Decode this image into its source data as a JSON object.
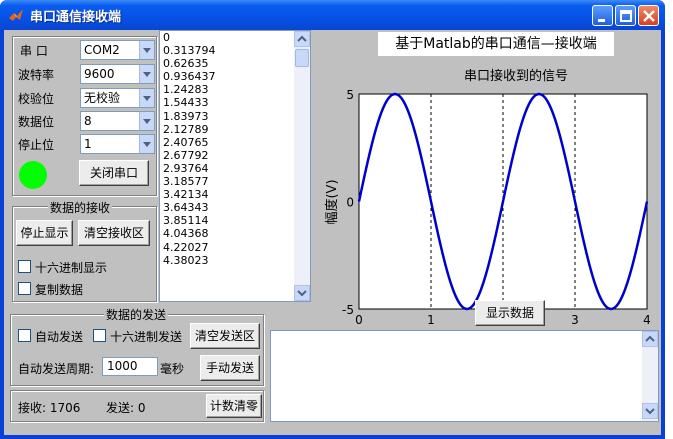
{
  "window": {
    "title": "串口通信接收端"
  },
  "serial_settings": {
    "port": {
      "label": "串  口",
      "value": "COM2"
    },
    "baud": {
      "label": "波特率",
      "value": "9600"
    },
    "parity": {
      "label": "校验位",
      "value": "无校验"
    },
    "data_bits": {
      "label": "数据位",
      "value": "8"
    },
    "stop_bits": {
      "label": "停止位",
      "value": "1"
    },
    "status_color": "#00ff00",
    "close_port_label": "关闭串口"
  },
  "receive": {
    "title": "数据的接收",
    "stop_display_label": "停止显示",
    "clear_receive_label": "清空接收区",
    "hex_display_label": "十六进制显示",
    "copy_data_label": "复制数据"
  },
  "data_list": [
    "0",
    "0.313794",
    "0.62635",
    "0.936437",
    "1.24283",
    "1.54433",
    "1.83973",
    "2.12789",
    "2.40765",
    "2.67792",
    "2.93764",
    "3.18577",
    "3.42134",
    "3.64343",
    "3.85114",
    "4.04368",
    "4.22027",
    "4.38023"
  ],
  "header": {
    "title": "基于Matlab的串口通信—接收端"
  },
  "chart": {
    "show_data_label": "显示数据"
  },
  "chart_data": {
    "type": "line",
    "title": "串口接收到的信号",
    "ylabel": "幅度(V)",
    "xlabel": "",
    "xlim": [
      0,
      4
    ],
    "ylim": [
      -5,
      5
    ],
    "xticks": [
      "0",
      "1",
      "2",
      "3",
      "4"
    ],
    "yticks": [
      "5",
      "0",
      "-5"
    ],
    "grid": "dashed-x",
    "series_color": "#0000cc",
    "series": [
      {
        "function": "5*sin(pi*x)",
        "x": [
          0,
          0.5,
          1,
          1.5,
          2,
          2.5,
          3,
          3.5,
          4
        ],
        "y": [
          0,
          5,
          0,
          -5,
          0,
          5,
          0,
          -5,
          0
        ]
      }
    ]
  },
  "send": {
    "title": "数据的发送",
    "auto_send_label": "自动发送",
    "hex_send_label": "十六进制发送",
    "clear_send_label": "清空发送区",
    "period_label": "自动发送周期:",
    "period_value": "1000",
    "period_unit": "毫秒",
    "manual_send_label": "手动发送"
  },
  "counter": {
    "received": "接收: 1706",
    "sent": "发送: 0",
    "reset_label": "计数清零"
  },
  "colors": {
    "titlebar": "#0552e5",
    "background": "#c0c0c0",
    "line": "#0000cc"
  }
}
